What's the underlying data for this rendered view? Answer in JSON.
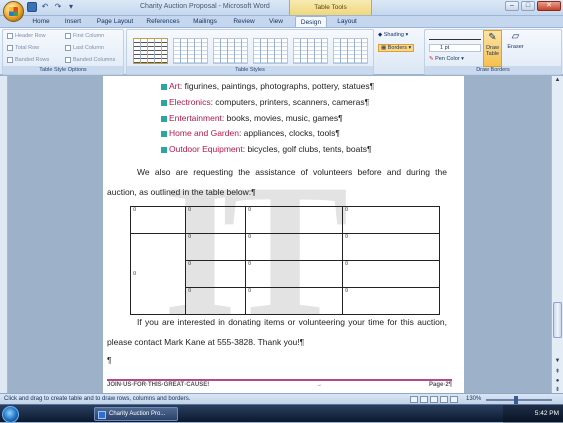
{
  "window": {
    "title": "Charity Auction Proposal - Microsoft Word",
    "context_tab_group": "Table Tools",
    "controls": {
      "minimize": "–",
      "maximize": "□",
      "close": "✕"
    }
  },
  "quick_access": {
    "undo": "↶",
    "redo": "↷"
  },
  "tabs": [
    "Home",
    "Insert",
    "Page Layout",
    "References",
    "Mailings",
    "Review",
    "View",
    "Design",
    "Layout"
  ],
  "active_tab": "Design",
  "ribbon": {
    "style_options": {
      "label": "Table Style Options",
      "checkboxes": [
        "Header Row",
        "First Column",
        "Total Row",
        "Last Column",
        "Banded Rows",
        "Banded Columns"
      ]
    },
    "table_styles": {
      "label": "Table Styles"
    },
    "shading_label": "Shading",
    "borders_label": "Borders",
    "draw_borders": {
      "label": "Draw Borders",
      "pen_weight": "1 pt",
      "pen_color": "Pen Color",
      "draw_table": "Draw Table",
      "eraser": "Eraser"
    }
  },
  "document": {
    "bullets": [
      {
        "category": "Art",
        "items": ": figurines, paintings, photographs, pottery, statues¶"
      },
      {
        "category": "Electronics",
        "items": ": computers, printers, scanners, cameras¶"
      },
      {
        "category": "Entertainment",
        "items": ": books, movies, music, games¶"
      },
      {
        "category": "Home and Garden",
        "items": ": appliances, clocks, tools¶"
      },
      {
        "category": "Outdoor Equipment",
        "items": ": bicycles, golf clubs, tents, boats¶"
      }
    ],
    "paragraph1": "We also are requesting the assistance of volunteers before and during the auction, as outlined in the table below:¶",
    "cell_mark": "¤",
    "paragraph2": "If you are interested in donating items or volunteering your time for this auction, please contact Mark Kane at 555-3828. Thank you!¶",
    "empty_para": "¶",
    "watermark": "IT",
    "footer_left": "JOIN·US·FOR·THIS·GREAT·CAUSE!",
    "footer_arrow": "→",
    "footer_right": "Page·2¶"
  },
  "statusbar": {
    "text": "Click and drag to create table and to draw rows, columns and borders.",
    "zoom": "130%"
  },
  "taskbar": {
    "item": "Charity Auction Pro...",
    "clock": "5:42 PM"
  }
}
